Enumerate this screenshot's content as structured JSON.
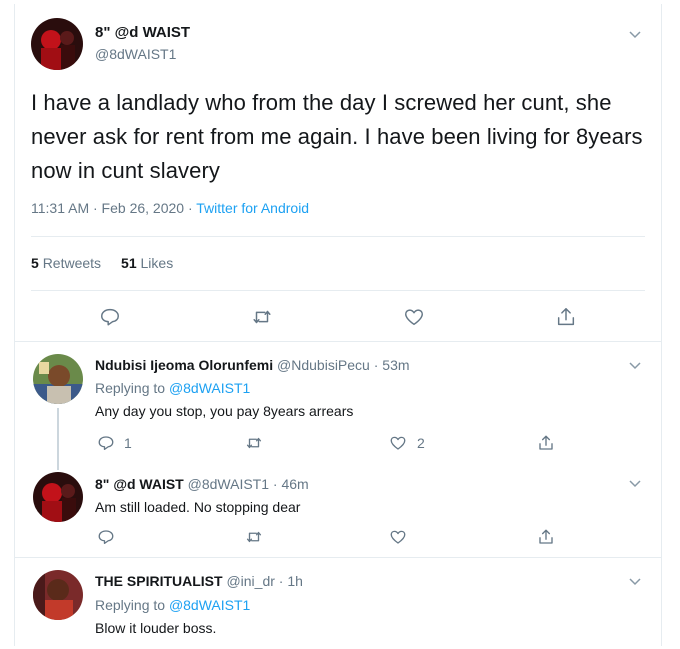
{
  "main_tweet": {
    "author_name": "8\" @d WAIST",
    "author_handle": "@8dWAIST1",
    "text": "I have a landlady who from the day I screwed her cunt, she never ask for rent from me again. I have been living for 8years now in cunt slavery",
    "timestamp": "11:31 AM · Feb 26, 2020 · ",
    "source": "Twitter for Android",
    "retweets_count": "5",
    "retweets_label": "Retweets",
    "likes_count": "51",
    "likes_label": "Likes"
  },
  "replies": [
    {
      "author_name": "Ndubisi Ijeoma Olorunfemi",
      "author_handle": "@NdubisiPecu · 53m",
      "replying_label": "Replying to ",
      "replying_to": "@8dWAIST1",
      "text": "Any day you stop, you pay 8years arrears",
      "reply_count": "1",
      "like_count": "2"
    },
    {
      "author_name": "8\" @d WAIST",
      "author_handle": "@8dWAIST1 · 46m",
      "text": "Am still loaded. No stopping dear"
    },
    {
      "author_name": "THE SPIRITUALIST",
      "author_handle": "@ini_dr · 1h",
      "replying_label": "Replying to ",
      "replying_to": "@8dWAIST1",
      "text": "Blow it louder boss."
    }
  ],
  "icons": {
    "reply": "reply-icon",
    "retweet": "retweet-icon",
    "like": "heart-icon",
    "share": "share-icon",
    "more": "chevron-down-icon"
  },
  "colors": {
    "accent": "#1da1f2",
    "secondary_text": "#657786",
    "divider": "#e6ecf0"
  }
}
